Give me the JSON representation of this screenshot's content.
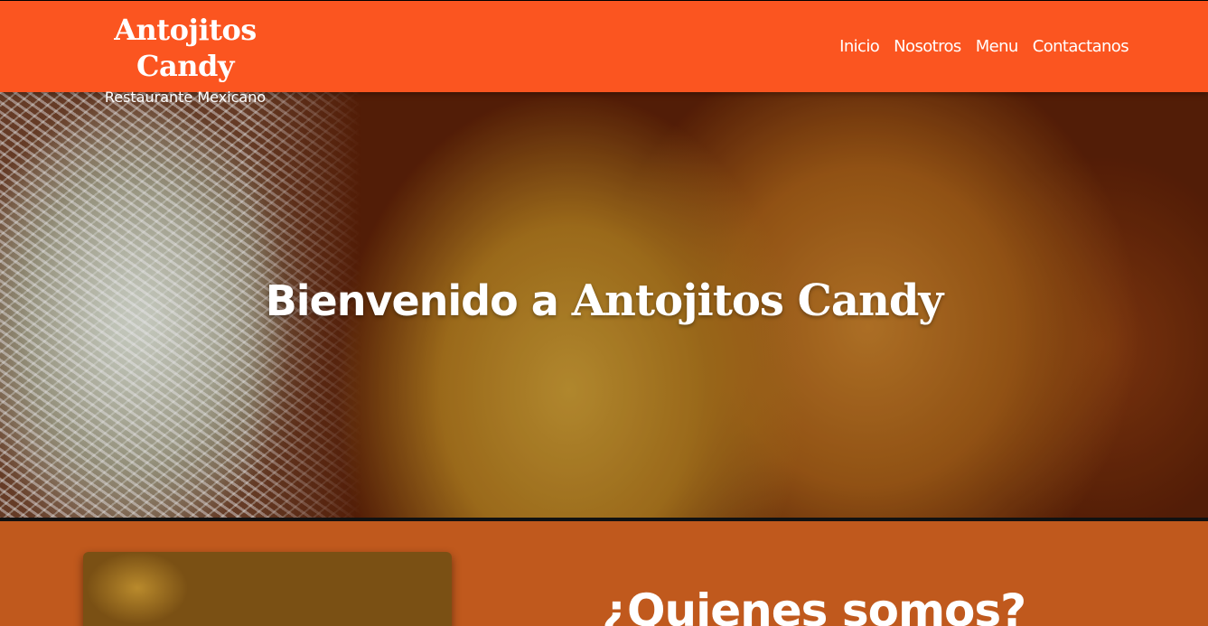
{
  "header": {
    "brand_title": "Antojitos Candy",
    "brand_subtitle": "Restaurante Mexicano",
    "nav": [
      "Inicio",
      "Nosotros",
      "Menu",
      "Contactanos"
    ]
  },
  "hero": {
    "welcome_prefix": "Bienvenido a ",
    "welcome_brand": "Antojitos Candy"
  },
  "about": {
    "title": "¿Quienes somos?"
  },
  "colors": {
    "header_bg": "#fb5520",
    "section_bg": "#c0591d",
    "text": "#ffffff"
  }
}
